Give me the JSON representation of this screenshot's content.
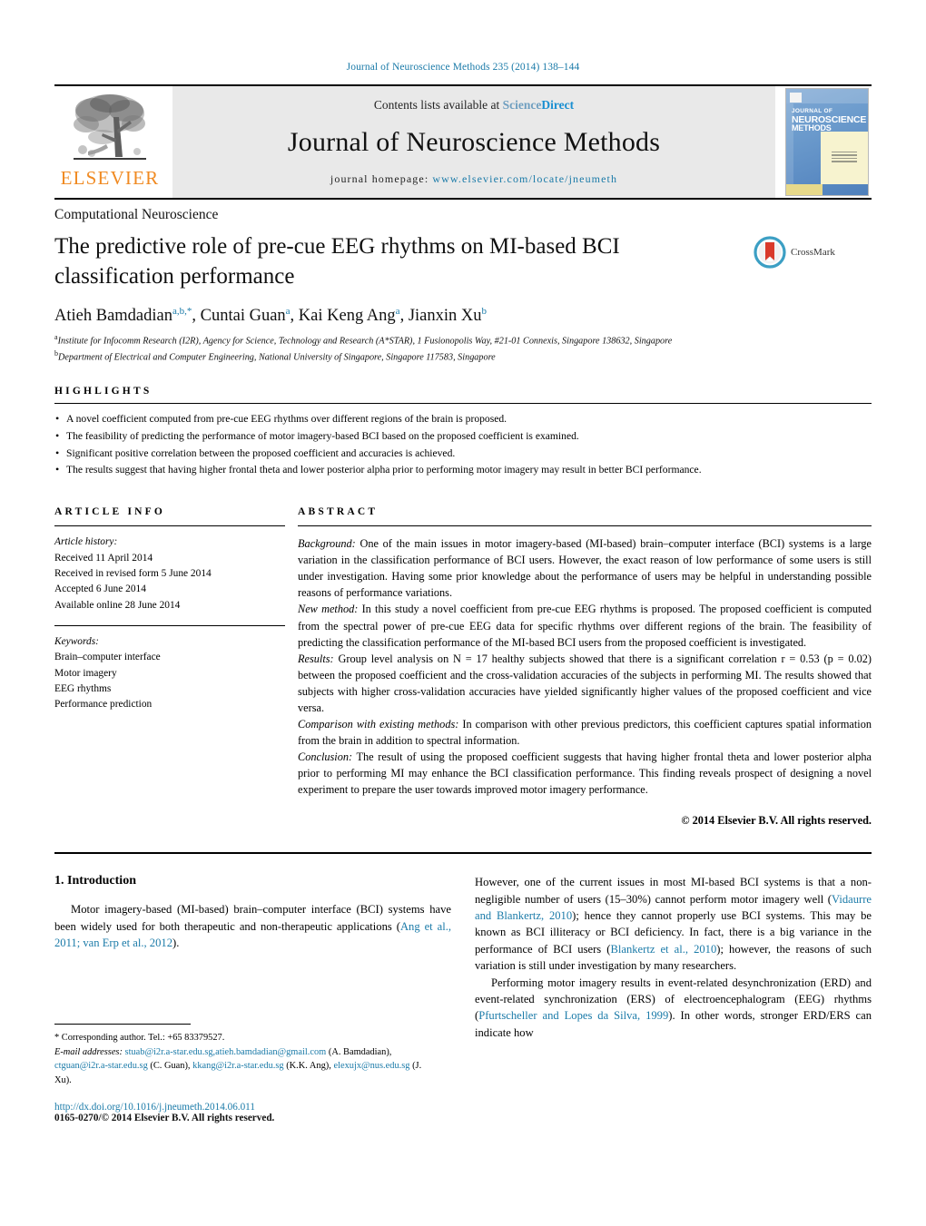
{
  "running_head": "Journal of Neuroscience Methods 235 (2014) 138–144",
  "masthead": {
    "publisher": "ELSEVIER",
    "contents_prefix": "Contents lists available at ",
    "sciencedirect_part1": "Science",
    "sciencedirect_part2": "Direct",
    "journal_name": "Journal of Neuroscience Methods",
    "homepage_prefix": "journal homepage: ",
    "homepage_url": "www.elsevier.com/locate/jneumeth",
    "cover": {
      "line1": "JOURNAL OF",
      "line2": "NEUROSCIENCE",
      "line3": "METHODS"
    }
  },
  "section_label": "Computational Neuroscience",
  "title": "The predictive role of pre-cue EEG rhythms on MI-based BCI classification performance",
  "crossmark_label": "CrossMark",
  "authors": [
    {
      "name": "Atieh Bamdadian",
      "sup": "a,b,*"
    },
    {
      "name": "Cuntai Guan",
      "sup": "a"
    },
    {
      "name": "Kai Keng Ang",
      "sup": "a"
    },
    {
      "name": "Jianxin Xu",
      "sup": "b"
    }
  ],
  "affiliations": [
    {
      "marker": "a",
      "text": "Institute for Infocomm Research (I2R), Agency for Science, Technology and Research (A*STAR), 1 Fusionopolis Way, #21-01 Connexis, Singapore 138632, Singapore"
    },
    {
      "marker": "b",
      "text": "Department of Electrical and Computer Engineering, National University of Singapore, Singapore 117583, Singapore"
    }
  ],
  "highlights": {
    "heading": "HIGHLIGHTS",
    "items": [
      "A novel coefficient computed from pre-cue EEG rhythms over different regions of the brain is proposed.",
      "The feasibility of predicting the performance of motor imagery-based BCI based on the proposed coefficient is examined.",
      "Significant positive correlation between the proposed coefficient and accuracies is achieved.",
      "The results suggest that having higher frontal theta and lower posterior alpha prior to performing motor imagery may result in better BCI performance."
    ]
  },
  "article_info": {
    "heading": "ARTICLE INFO",
    "history_label": "Article history:",
    "history": [
      "Received 11 April 2014",
      "Received in revised form 5 June 2014",
      "Accepted 6 June 2014",
      "Available online 28 June 2014"
    ],
    "keywords_label": "Keywords:",
    "keywords": [
      "Brain–computer interface",
      "Motor imagery",
      "EEG rhythms",
      "Performance prediction"
    ]
  },
  "abstract": {
    "heading": "ABSTRACT",
    "paragraphs": [
      {
        "lead": "Background:",
        "text": " One of the main issues in motor imagery-based (MI-based) brain–computer interface (BCI) systems is a large variation in the classification performance of BCI users. However, the exact reason of low performance of some users is still under investigation. Having some prior knowledge about the performance of users may be helpful in understanding possible reasons of performance variations."
      },
      {
        "lead": "New method:",
        "text": " In this study a novel coefficient from pre-cue EEG rhythms is proposed. The proposed coefficient is computed from the spectral power of pre-cue EEG data for specific rhythms over different regions of the brain. The feasibility of predicting the classification performance of the MI-based BCI users from the proposed coefficient is investigated."
      },
      {
        "lead": "Results:",
        "text": " Group level analysis on N = 17 healthy subjects showed that there is a significant correlation r = 0.53 (p = 0.02) between the proposed coefficient and the cross-validation accuracies of the subjects in performing MI. The results showed that subjects with higher cross-validation accuracies have yielded significantly higher values of the proposed coefficient and vice versa."
      },
      {
        "lead": "Comparison with existing methods:",
        "text": " In comparison with other previous predictors, this coefficient captures spatial information from the brain in addition to spectral information."
      },
      {
        "lead": "Conclusion:",
        "text": " The result of using the proposed coefficient suggests that having higher frontal theta and lower posterior alpha prior to performing MI may enhance the BCI classification performance. This finding reveals prospect of designing a novel experiment to prepare the user towards improved motor imagery performance."
      }
    ],
    "copyright": "© 2014 Elsevier B.V. All rights reserved."
  },
  "introduction": {
    "number_title": "1.  Introduction",
    "left_paragraph_1_a": "Motor imagery-based (MI-based) brain–computer interface (BCI) systems have been widely used for both therapeutic and non-therapeutic applications (",
    "left_paragraph_1_ref": "Ang et al., 2011; van Erp et al., 2012",
    "left_paragraph_1_b": ").",
    "right_paragraph_1_a": "However, one of the current issues in most MI-based BCI systems is that a non-negligible number of users (15–30%) cannot perform motor imagery well (",
    "right_paragraph_1_ref1": "Vidaurre and Blankertz, 2010",
    "right_paragraph_1_b": "); hence they cannot properly use BCI systems. This may be known as BCI illiteracy or BCI deficiency. In fact, there is a big variance in the performance of BCI users (",
    "right_paragraph_1_ref2": "Blankertz et al., 2010",
    "right_paragraph_1_c": "); however, the reasons of such variation is still under investigation by many researchers.",
    "right_paragraph_2_a": "Performing motor imagery results in event-related desynchronization (ERD) and event-related synchronization (ERS) of electroencephalogram (EEG) rhythms (",
    "right_paragraph_2_ref": "Pfurtscheller and Lopes da Silva, 1999",
    "right_paragraph_2_b": "). In other words, stronger ERD/ERS can indicate how"
  },
  "footnotes": {
    "corresponding": "* Corresponding author. Tel.: +65 83379527.",
    "email_label": "E-mail addresses:",
    "emails": [
      {
        "address": "stuab@i2r.a-star.edu.sg,",
        "owner": ""
      },
      {
        "address": "atieh.bamdadian@gmail.com",
        "owner": " (A. Bamdadian), "
      },
      {
        "address": "ctguan@i2r.a-star.edu.sg",
        "owner": " (C. Guan), "
      },
      {
        "address": "kkang@i2r.a-star.edu.sg",
        "owner": " (K.K. Ang), "
      },
      {
        "address": "elexujx@nus.edu.sg",
        "owner": " (J. Xu)."
      }
    ],
    "doi": "http://dx.doi.org/10.1016/j.jneumeth.2014.06.011",
    "issn": "0165-0270/© 2014 Elsevier B.V. All rights reserved."
  },
  "colors": {
    "link_blue": "#1a7aa8",
    "elsevier_orange": "#F08A22",
    "sciencedirect_blue": "#1a8fd1"
  }
}
